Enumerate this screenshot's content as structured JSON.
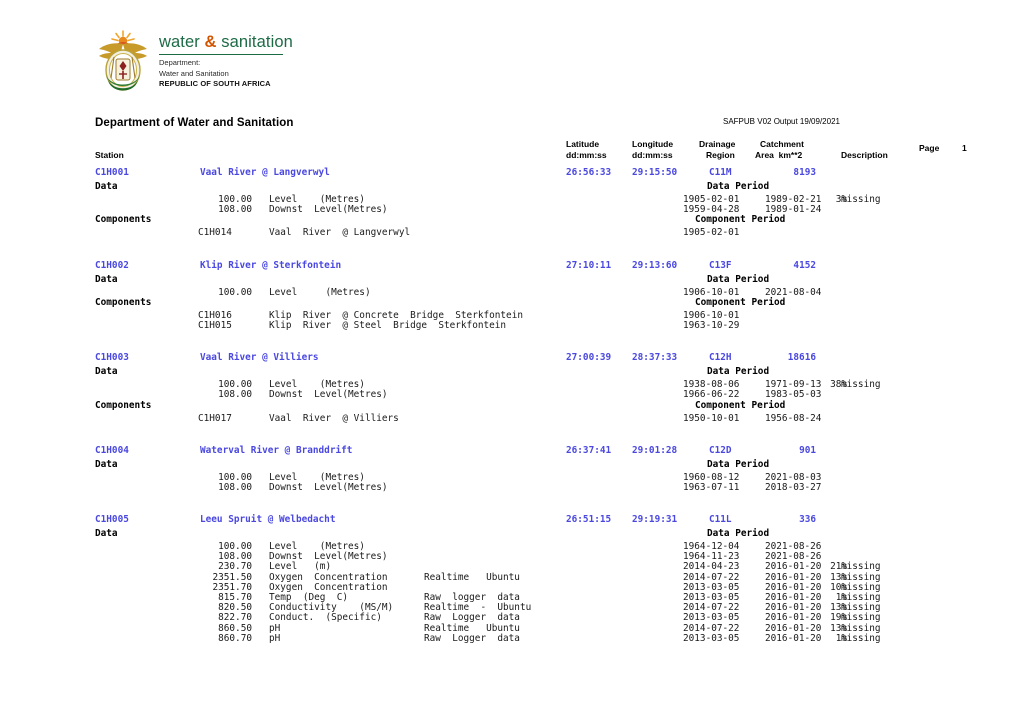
{
  "logo": {
    "emblem_icon": "south-africa-coat-of-arms-icon",
    "wordmark_part1": "water ",
    "wordmark_amp": "&",
    "wordmark_part2": " sanitation",
    "sub_line1": "Department:",
    "sub_line2": "Water and Sanitation",
    "sub_line3": "REPUBLIC OF SOUTH AFRICA",
    "green": "#1d6b45",
    "amp_color": "#d35400"
  },
  "header": {
    "department_title": "Department of Water and Sanitation",
    "output_stamp": "SAFPUB V02 Output 19/09/2021",
    "page_label": "Page",
    "page_number": "1",
    "columns": {
      "station": "Station",
      "latitude_l1": "Latitude",
      "latitude_l2": "dd:mm:ss",
      "longitude_l1": "Longitude",
      "longitude_l2": "dd:mm:ss",
      "drainage_l1": "Drainage",
      "drainage_l2": "Region",
      "catchment_l1": "Catchment",
      "catchment_l2": "Area  km**2",
      "description": "Description"
    }
  },
  "labels": {
    "data": "Data",
    "components": "Components",
    "data_period": "Data Period",
    "component_period": "Component Period",
    "missing": "missing"
  },
  "accent_blue": "#4a48e0",
  "stations": [
    {
      "code": "C1H001",
      "name": "Vaal River @ Langverwyl",
      "latitude": "26:56:33",
      "longitude": "29:15:50",
      "drainage_region": "C11M",
      "catchment_area": "8193",
      "description": "",
      "data": [
        {
          "amount": "100.00",
          "type": "Level    (Metres)",
          "source": "",
          "start": "1905-02-01",
          "end": "1989-02-21",
          "pct": "3%",
          "missing": "missing"
        },
        {
          "amount": "108.00",
          "type": "Downst  Level(Metres)",
          "source": "",
          "start": "1959-04-28",
          "end": "1989-01-24",
          "pct": "",
          "missing": ""
        }
      ],
      "components": [
        {
          "code": "C1H014",
          "desc": "Vaal  River  @ Langverwyl",
          "start": "1905-02-01",
          "end": ""
        }
      ]
    },
    {
      "code": "C1H002",
      "name": "Klip River @ Sterkfontein",
      "latitude": "27:10:11",
      "longitude": "29:13:60",
      "drainage_region": "C13F",
      "catchment_area": "4152",
      "description": "",
      "data": [
        {
          "amount": "100.00",
          "type": "Level     (Metres)",
          "source": "",
          "start": "1906-10-01",
          "end": "2021-08-04",
          "pct": "",
          "missing": ""
        }
      ],
      "components": [
        {
          "code": "C1H016",
          "desc": "Klip  River  @ Concrete  Bridge  Sterkfontein",
          "start": "1906-10-01",
          "end": ""
        },
        {
          "code": "C1H015",
          "desc": "Klip  River  @ Steel  Bridge  Sterkfontein",
          "start": "1963-10-29",
          "end": ""
        }
      ]
    },
    {
      "code": "C1H003",
      "name": "Vaal River @ Villiers",
      "latitude": "27:00:39",
      "longitude": "28:37:33",
      "drainage_region": "C12H",
      "catchment_area": "18616",
      "description": "",
      "data": [
        {
          "amount": "100.00",
          "type": "Level    (Metres)",
          "source": "",
          "start": "1938-08-06",
          "end": "1971-09-13",
          "pct": "38%",
          "missing": "missing"
        },
        {
          "amount": "108.00",
          "type": "Downst  Level(Metres)",
          "source": "",
          "start": "1966-06-22",
          "end": "1983-05-03",
          "pct": "",
          "missing": ""
        }
      ],
      "components": [
        {
          "code": "C1H017",
          "desc": "Vaal  River  @ Villiers",
          "start": "1950-10-01",
          "end": "1956-08-24"
        }
      ]
    },
    {
      "code": "C1H004",
      "name": "Waterval River @ Branddrift",
      "latitude": "26:37:41",
      "longitude": "29:01:28",
      "drainage_region": "C12D",
      "catchment_area": "901",
      "description": "",
      "data": [
        {
          "amount": "100.00",
          "type": "Level    (Metres)",
          "source": "",
          "start": "1960-08-12",
          "end": "2021-08-03",
          "pct": "",
          "missing": ""
        },
        {
          "amount": "108.00",
          "type": "Downst  Level(Metres)",
          "source": "",
          "start": "1963-07-11",
          "end": "2018-03-27",
          "pct": "",
          "missing": ""
        }
      ],
      "components": []
    },
    {
      "code": "C1H005",
      "name": "Leeu Spruit @ Welbedacht",
      "latitude": "26:51:15",
      "longitude": "29:19:31",
      "drainage_region": "C11L",
      "catchment_area": "336",
      "description": "",
      "data": [
        {
          "amount": "100.00",
          "type": "Level    (Metres)",
          "source": "",
          "start": "1964-12-04",
          "end": "2021-08-26",
          "pct": "",
          "missing": ""
        },
        {
          "amount": "108.00",
          "type": "Downst  Level(Metres)",
          "source": "",
          "start": "1964-11-23",
          "end": "2021-08-26",
          "pct": "",
          "missing": ""
        },
        {
          "amount": "230.70",
          "type": "Level   (m)",
          "source": "",
          "start": "2014-04-23",
          "end": "2016-01-20",
          "pct": "21%",
          "missing": "missing"
        },
        {
          "amount": "2351.50",
          "type": "Oxygen  Concentration",
          "source": "Realtime   Ubuntu",
          "start": "2014-07-22",
          "end": "2016-01-20",
          "pct": "13%",
          "missing": "missing"
        },
        {
          "amount": "2351.70",
          "type": "Oxygen  Concentration",
          "source": "",
          "start": "2013-03-05",
          "end": "2016-01-20",
          "pct": "10%",
          "missing": "missing"
        },
        {
          "amount": "815.70",
          "type": "Temp  (Deg  C)",
          "source": "Raw  logger  data",
          "start": "2013-03-05",
          "end": "2016-01-20",
          "pct": "1%",
          "missing": "missing"
        },
        {
          "amount": "820.50",
          "type": "Conductivity    (MS/M)",
          "source": "Realtime  -  Ubuntu",
          "start": "2014-07-22",
          "end": "2016-01-20",
          "pct": "13%",
          "missing": "missing"
        },
        {
          "amount": "822.70",
          "type": "Conduct.  (Specific)",
          "source": "Raw  Logger  data",
          "start": "2013-03-05",
          "end": "2016-01-20",
          "pct": "19%",
          "missing": "missing"
        },
        {
          "amount": "860.50",
          "type": "pH",
          "source": "Realtime   Ubuntu",
          "start": "2014-07-22",
          "end": "2016-01-20",
          "pct": "13%",
          "missing": "missing"
        },
        {
          "amount": "860.70",
          "type": "pH",
          "source": "Raw  Logger  data",
          "start": "2013-03-05",
          "end": "2016-01-20",
          "pct": "1%",
          "missing": "missing"
        }
      ],
      "components": []
    }
  ]
}
